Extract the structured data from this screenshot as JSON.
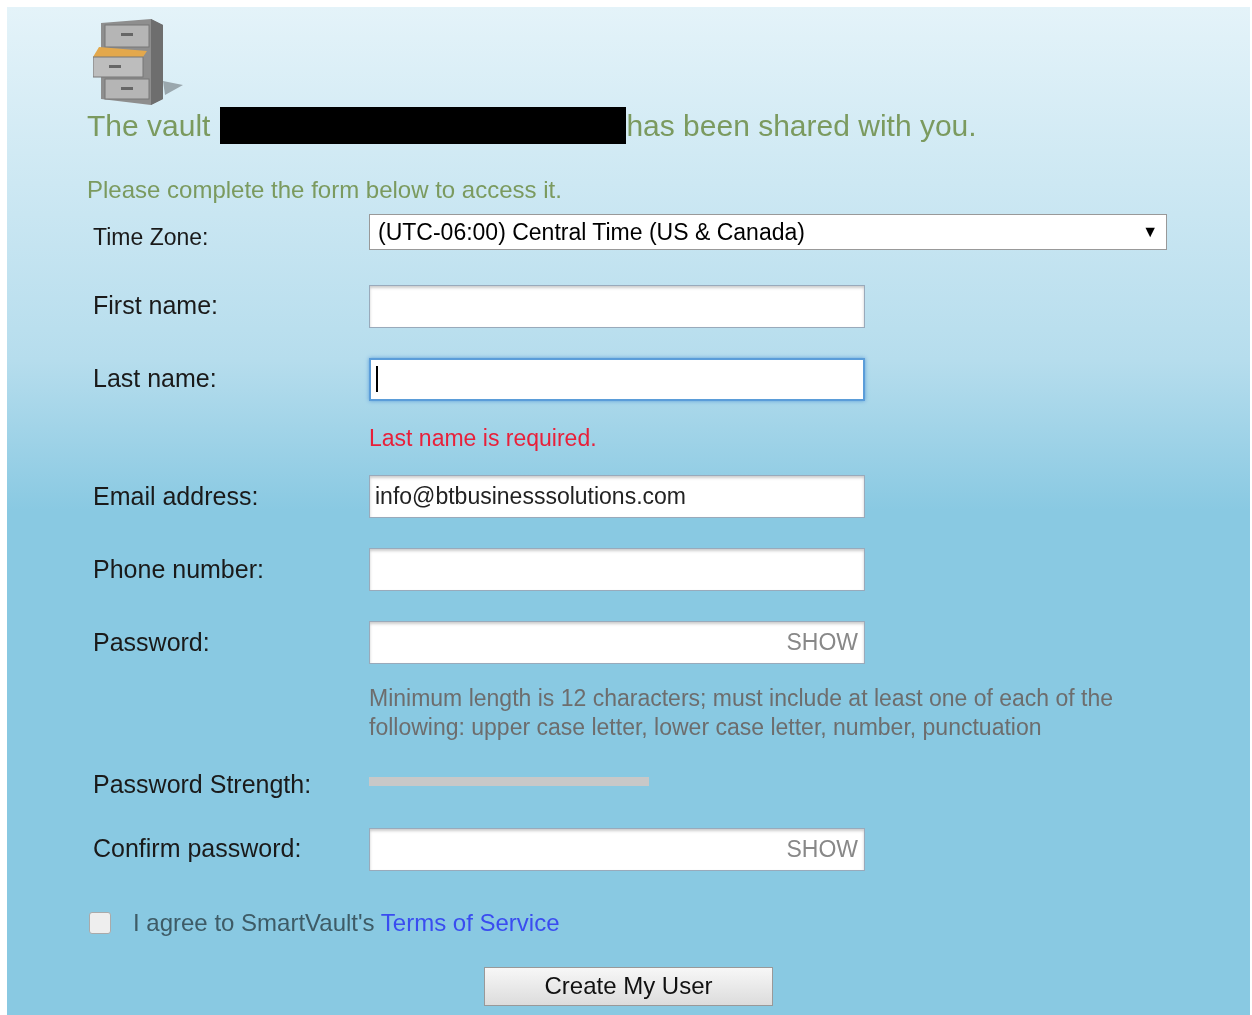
{
  "heading": {
    "before": "The vault",
    "after": "has been shared with you."
  },
  "intro": "Please complete the form below to access it.",
  "fields": [
    {
      "kind": "select",
      "label": "Time Zone:",
      "value": "(UTC-06:00) Central Time (US & Canada)",
      "arrow": "▼"
    },
    {
      "kind": "text",
      "label": "First name:",
      "focused": false
    },
    {
      "kind": "text",
      "label": "Last name:",
      "focused": true,
      "error": "Last name is required."
    },
    {
      "kind": "text",
      "label": "Email address:",
      "value": "info@btbusinesssolutions.com",
      "focused": false
    },
    {
      "kind": "text",
      "label": "Phone number:",
      "focused": false
    },
    {
      "kind": "password",
      "label": "Password:",
      "toggle": "SHOW",
      "hint": "Minimum length is 12 characters; must include at least one of each of the following: upper case letter, lower case letter, number, punctuation"
    },
    {
      "kind": "strength",
      "label": "Password Strength:",
      "level": 0
    },
    {
      "kind": "password",
      "label": "Confirm password:",
      "toggle": "SHOW"
    }
  ],
  "agree": {
    "checked": false,
    "text": "I agree to SmartVault's",
    "link": "Terms of Service"
  },
  "submit": "Create My User"
}
